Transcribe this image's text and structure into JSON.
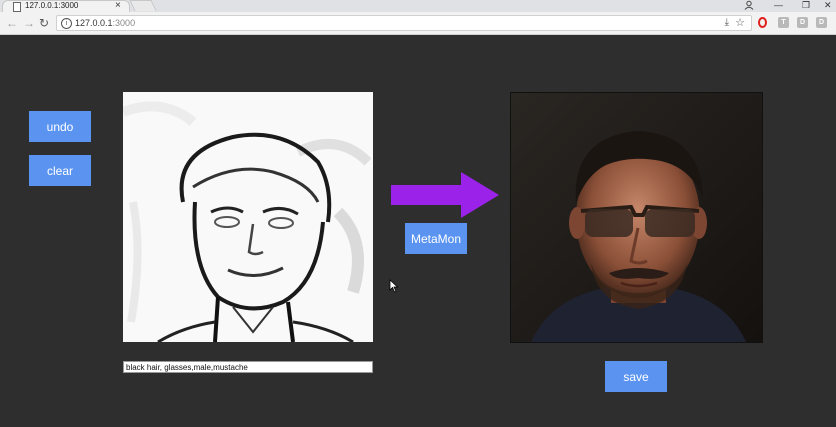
{
  "browser": {
    "tab_title": "127.0.0.1:3000",
    "tab_close": "×",
    "url_host": "127.0.0.1",
    "url_port": ":3000",
    "window_controls": [
      "—",
      "❐",
      "✕"
    ],
    "extensions": [
      "T",
      "D",
      "D"
    ]
  },
  "app": {
    "undo_label": "undo",
    "clear_label": "clear",
    "generate_label": "MetaMon",
    "save_label": "save",
    "attributes_value": "black hair, glasses,male,mustache"
  },
  "colors": {
    "button": "#5b94f0",
    "arrow": "#9b22e8",
    "background": "#2e2e2e"
  },
  "icons": [
    "page-icon",
    "close-icon",
    "back-icon",
    "forward-icon",
    "reload-icon",
    "info-icon",
    "download-icon",
    "star-icon",
    "opera-icon",
    "account-icon",
    "cursor-icon",
    "arrow-right-icon"
  ]
}
